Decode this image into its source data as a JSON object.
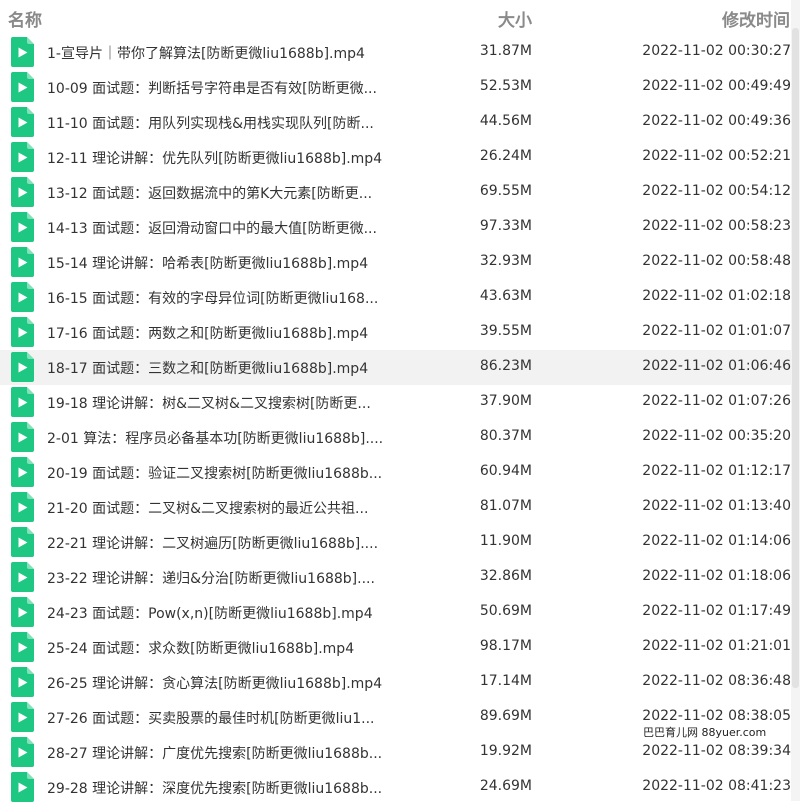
{
  "header": {
    "name": "名称",
    "size": "大小",
    "time": "修改时间"
  },
  "icon": {
    "name": "video-file-icon",
    "color": "#1ec882"
  },
  "watermark": "巴巴育儿网 88yuer.com",
  "files": [
    {
      "name": "1-宣导片｜带你了解算法[防断更微liu1688b].mp4",
      "size": "31.87M",
      "time": "2022-11-02 00:30:27"
    },
    {
      "name": "10-09 面试题：判断括号字符串是否有效[防断更微...",
      "size": "52.53M",
      "time": "2022-11-02 00:49:49"
    },
    {
      "name": "11-10 面试题：用队列实现栈&用栈实现队列[防断...",
      "size": "44.56M",
      "time": "2022-11-02 00:49:36"
    },
    {
      "name": "12-11 理论讲解：优先队列[防断更微liu1688b].mp4",
      "size": "26.24M",
      "time": "2022-11-02 00:52:21"
    },
    {
      "name": "13-12 面试题：返回数据流中的第K大元素[防断更...",
      "size": "69.55M",
      "time": "2022-11-02 00:54:12"
    },
    {
      "name": "14-13 面试题：返回滑动窗口中的最大值[防断更微...",
      "size": "97.33M",
      "time": "2022-11-02 00:58:23"
    },
    {
      "name": "15-14 理论讲解：哈希表[防断更微liu1688b].mp4",
      "size": "32.93M",
      "time": "2022-11-02 00:58:48"
    },
    {
      "name": "16-15 面试题：有效的字母异位词[防断更微liu168...",
      "size": "43.63M",
      "time": "2022-11-02 01:02:18"
    },
    {
      "name": "17-16 面试题：两数之和[防断更微liu1688b].mp4",
      "size": "39.55M",
      "time": "2022-11-02 01:01:07"
    },
    {
      "name": "18-17 面试题：三数之和[防断更微liu1688b].mp4",
      "size": "86.23M",
      "time": "2022-11-02 01:06:46",
      "highlight": true
    },
    {
      "name": "19-18 理论讲解：树&二叉树&二叉搜索树[防断更...",
      "size": "37.90M",
      "time": "2022-11-02 01:07:26"
    },
    {
      "name": "2-01 算法：程序员必备基本功[防断更微liu1688b]....",
      "size": "80.37M",
      "time": "2022-11-02 00:35:20"
    },
    {
      "name": "20-19 面试题：验证二叉搜索树[防断更微liu1688b...",
      "size": "60.94M",
      "time": "2022-11-02 01:12:17"
    },
    {
      "name": "21-20 面试题：二叉树&二叉搜索树的最近公共祖...",
      "size": "81.07M",
      "time": "2022-11-02 01:13:40"
    },
    {
      "name": "22-21 理论讲解：二叉树遍历[防断更微liu1688b]....",
      "size": "11.90M",
      "time": "2022-11-02 01:14:06"
    },
    {
      "name": "23-22 理论讲解：递归&分治[防断更微liu1688b]....",
      "size": "32.86M",
      "time": "2022-11-02 01:18:06"
    },
    {
      "name": "24-23 面试题：Pow(x,n)[防断更微liu1688b].mp4",
      "size": "50.69M",
      "time": "2022-11-02 01:17:49"
    },
    {
      "name": "25-24 面试题：求众数[防断更微liu1688b].mp4",
      "size": "98.17M",
      "time": "2022-11-02 01:21:01"
    },
    {
      "name": "26-25 理论讲解：贪心算法[防断更微liu1688b].mp4",
      "size": "17.14M",
      "time": "2022-11-02 08:36:48"
    },
    {
      "name": "27-26 面试题：买卖股票的最佳时机[防断更微liu1...",
      "size": "89.69M",
      "time": "2022-11-02 08:38:05"
    },
    {
      "name": "28-27 理论讲解：广度优先搜索[防断更微liu1688b...",
      "size": "19.92M",
      "time": "2022-11-02 08:39:34"
    },
    {
      "name": "29-28 理论讲解：深度优先搜索[防断更微liu1688b...",
      "size": "24.69M",
      "time": "2022-11-02 08:41:23"
    }
  ]
}
